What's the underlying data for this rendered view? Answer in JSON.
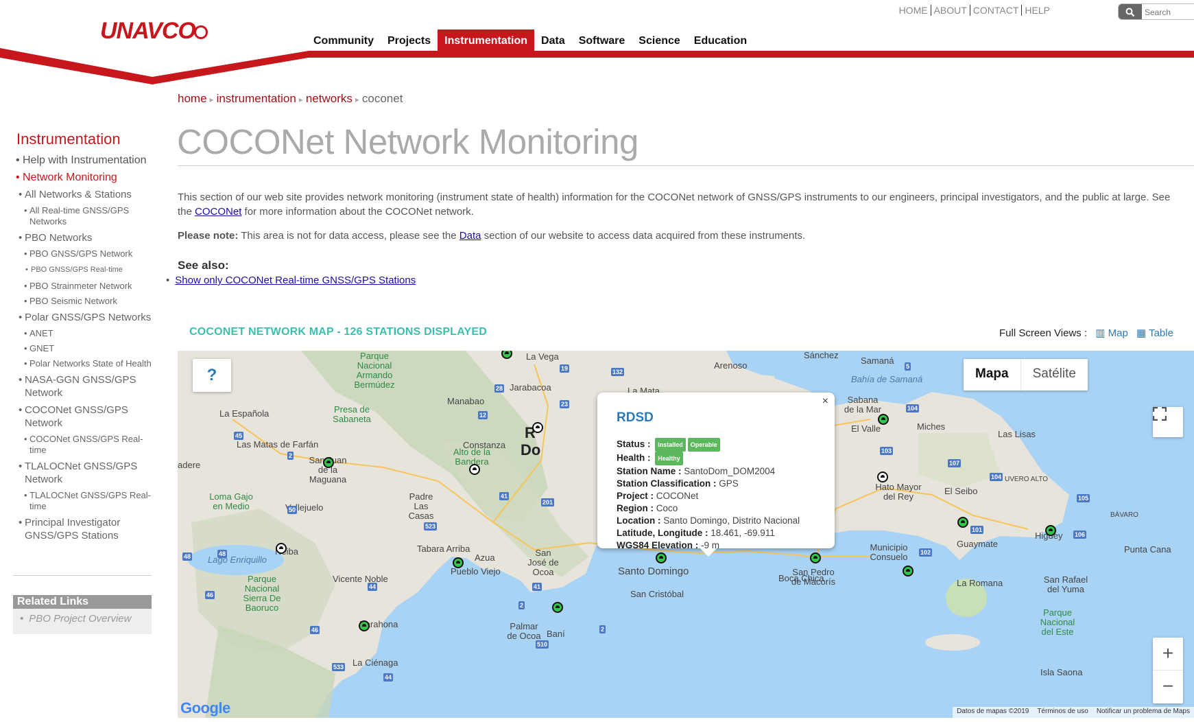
{
  "header": {
    "logo_text": "UNAVCO",
    "top_links": [
      "HOME",
      "ABOUT",
      "CONTACT",
      "HELP"
    ],
    "search_placeholder": "Search",
    "nav": [
      "Community",
      "Projects",
      "Instrumentation",
      "Data",
      "Software",
      "Science",
      "Education"
    ],
    "active_nav": "Instrumentation",
    "brand_color": "#c8161d"
  },
  "breadcrumb": {
    "home": "home",
    "instrumentation": "instrumentation",
    "networks": "networks",
    "current": "coconet"
  },
  "page_title": "COCONet Network Monitoring",
  "content": {
    "p1_a": "This section of our web site provides network monitoring (instrument state of health) information for the COCONet network of GNSS/GPS instruments to our engineers, principal investigators, and the public at large. See the ",
    "p1_link": "COCONet",
    "p1_b": " for more information about the COCONet network.",
    "p2_label": "Please note:",
    "p2_a": " This area is not for data access, please see the ",
    "p2_link": "Data",
    "p2_b": " section of our website to access data acquired from these instruments.",
    "see_also": "See also:",
    "see_also_link": "Show only COCONet Real-time GNSS/GPS Stations"
  },
  "sidebar": {
    "title": "Instrumentation",
    "items": [
      {
        "label": "Help with Instrumentation",
        "level": 1
      },
      {
        "label": "Network Monitoring",
        "level": 1
      },
      {
        "label": "All Networks & Stations",
        "level": 2
      },
      {
        "label": "All Real-time GNSS/GPS Networks",
        "level": 3
      },
      {
        "label": "PBO Networks",
        "level": 2
      },
      {
        "label": "PBO GNSS/GPS Network",
        "level": 3
      },
      {
        "label": "PBO GNSS/GPS Real-time",
        "level": 4
      },
      {
        "label": "PBO Strainmeter Network",
        "level": 3
      },
      {
        "label": "PBO Seismic Network",
        "level": 3
      },
      {
        "label": "Polar GNSS/GPS Networks",
        "level": 2
      },
      {
        "label": "ANET",
        "level": 3
      },
      {
        "label": "GNET",
        "level": 3
      },
      {
        "label": "Polar Networks State of Health",
        "level": 3
      },
      {
        "label": "NASA-GGN GNSS/GPS Network",
        "level": 2
      },
      {
        "label": "COCONet GNSS/GPS Network",
        "level": 2
      },
      {
        "label": "COCONet GNSS/GPS Real-time",
        "level": 3
      },
      {
        "label": "TLALOCNet GNSS/GPS Network",
        "level": 2
      },
      {
        "label": "TLALOCNet GNSS/GPS Real-time",
        "level": 3
      },
      {
        "label": "Principal Investigator GNSS/GPS Stations",
        "level": 2
      }
    ],
    "related_title": "Related Links",
    "related_item": "PBO Project Overview"
  },
  "map_section": {
    "heading": "COCONET NETWORK MAP - 126 STATIONS DISPLAYED",
    "fullscreen_label": "Full Screen Views :",
    "fs_map": "Map",
    "fs_table": "Table",
    "help": "?",
    "maptype_map": "Mapa",
    "maptype_sat": "Satélite",
    "zoom_in": "+",
    "zoom_out": "−",
    "google": "Google",
    "footer": [
      "Datos de mapas ©2019",
      "Términos de uso",
      "Notificar un problema de Maps"
    ],
    "labels": [
      "La Española",
      "Las Matas de Farfán",
      "San Juan de la Maguana",
      "Loma Gajo en Medio",
      "Vallejuelo",
      "Lago Enriquillo",
      "Neiba",
      "Parque Nacional Sierra De Baoruco",
      "Vicente Noble",
      "Barahona",
      "La Ciénaga",
      "Pueblo Viejo",
      "Azua",
      "Padre Las Casas",
      "Tabara Arriba",
      "San José de Ocoa",
      "Palmar de Ocoa",
      "Baní",
      "Presa de Sabaneta",
      "Manabao",
      "Jarabacoa",
      "Constanza",
      "Alto de la Bandera",
      "Parque Nacional Armando Bermúdez",
      "La Vega",
      "La Mata",
      "Arenoso",
      "Sánchez",
      "Samaná",
      "Bahía de Samaná",
      "Sabana de la Mar",
      "El Valle",
      "Miches",
      "Las Lisas",
      "Hato Mayor del Rey",
      "El Seibo",
      "UVERO ALTO",
      "BÁVARO",
      "Guaymate",
      "Municipio Consuelo",
      "Higüey",
      "Punta Cana",
      "San Pedro de Macorís",
      "La Romana",
      "Boca Chica",
      "Santo Domingo",
      "San Cristóbal",
      "San Rafael del Yuma",
      "Parque Nacional del Este",
      "Isla Saona",
      "adere",
      "R",
      "Do"
    ]
  },
  "infowindow": {
    "title": "RDSD",
    "status_label": "Status :",
    "status_badges": [
      "Installed",
      "Operable"
    ],
    "health_label": "Health :",
    "health_badge": "Healthy",
    "station_name_label": "Station Name :",
    "station_name": "SantoDom_DOM2004",
    "classification_label": "Station Classification :",
    "classification": "GPS",
    "project_label": "Project :",
    "project": "COCONet",
    "region_label": "Region :",
    "region": "Coco",
    "location_label": "Location :",
    "location": "Santo Domingo, Distrito Nacional",
    "latlon_label": "Latitude, Longitude :",
    "latlon": "18.461, -69.911",
    "elevation_label": "WGS84 Elevation :",
    "elevation": "-9 m",
    "close": "×"
  }
}
